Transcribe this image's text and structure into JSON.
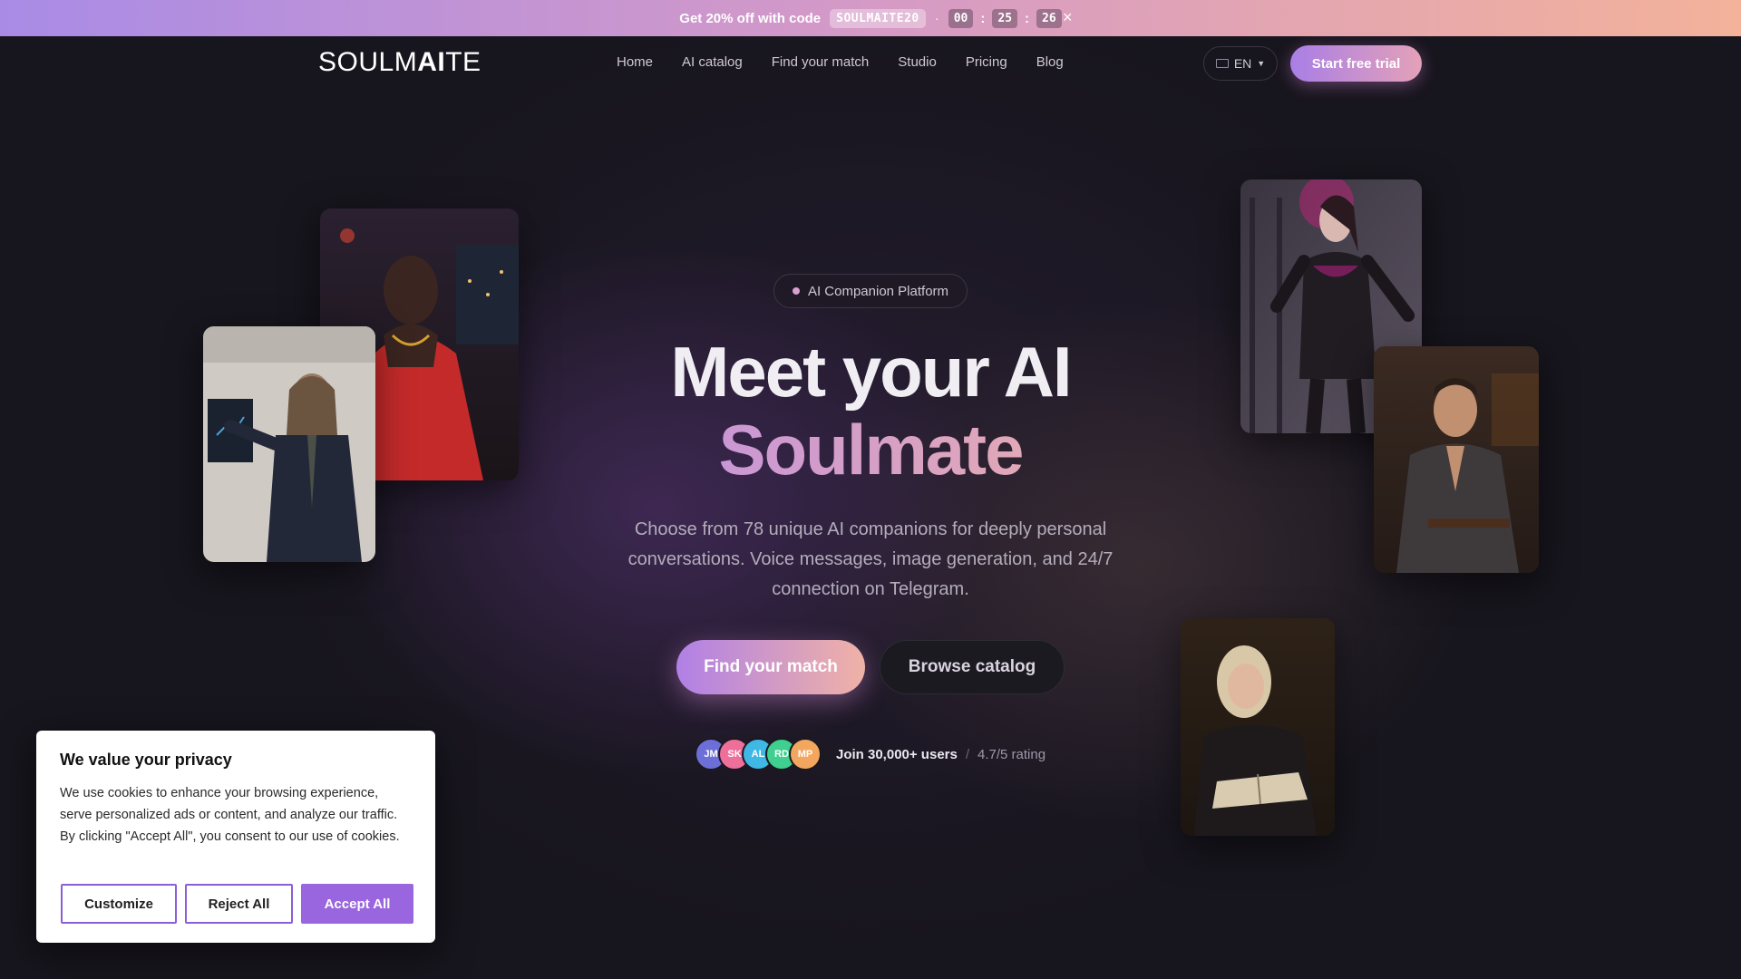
{
  "promo": {
    "text": "Get 20% off with code",
    "code": "SOULMAITE20",
    "separator": "·",
    "timer": [
      "00",
      "25",
      "26"
    ],
    "colon": ":",
    "close_glyph": "×"
  },
  "nav": {
    "logo_light": "SOULM",
    "logo_bold": "AI",
    "logo_tail": "TE",
    "links": [
      "Home",
      "AI catalog",
      "Find your match",
      "Studio",
      "Pricing",
      "Blog"
    ],
    "language": "EN",
    "cta": "Start free trial"
  },
  "hero": {
    "badge": "AI Companion Platform",
    "title_line1": "Meet your AI",
    "title_line2": "Soulmate",
    "subtitle": "Choose from 78 unique AI companions for deeply personal conversations. Voice messages, image generation, and 24/7 connection on Telegram.",
    "primary_button": "Find your match",
    "secondary_button": "Browse catalog",
    "avatars": [
      {
        "initials": "JM",
        "color": "#6d6fd9"
      },
      {
        "initials": "SK",
        "color": "#ef6f9b"
      },
      {
        "initials": "AL",
        "color": "#3fb8e6"
      },
      {
        "initials": "RD",
        "color": "#3fcf8e"
      },
      {
        "initials": "MP",
        "color": "#f2a65e"
      }
    ],
    "join_text": "Join 30,000+ users",
    "rating_separator": "/",
    "rating": "4.7/5 rating"
  },
  "cookie": {
    "title": "We value your privacy",
    "body": "We use cookies to enhance your browsing experience, serve personalized ads or content, and analyze our traffic. By clicking \"Accept All\", you consent to our use of cookies.",
    "customize": "Customize",
    "reject": "Reject All",
    "accept": "Accept All"
  },
  "colors": {
    "accent": "#9a66df",
    "gradient_start": "#b080e6",
    "gradient_end": "#f0b2a6",
    "background": "#17151d"
  }
}
